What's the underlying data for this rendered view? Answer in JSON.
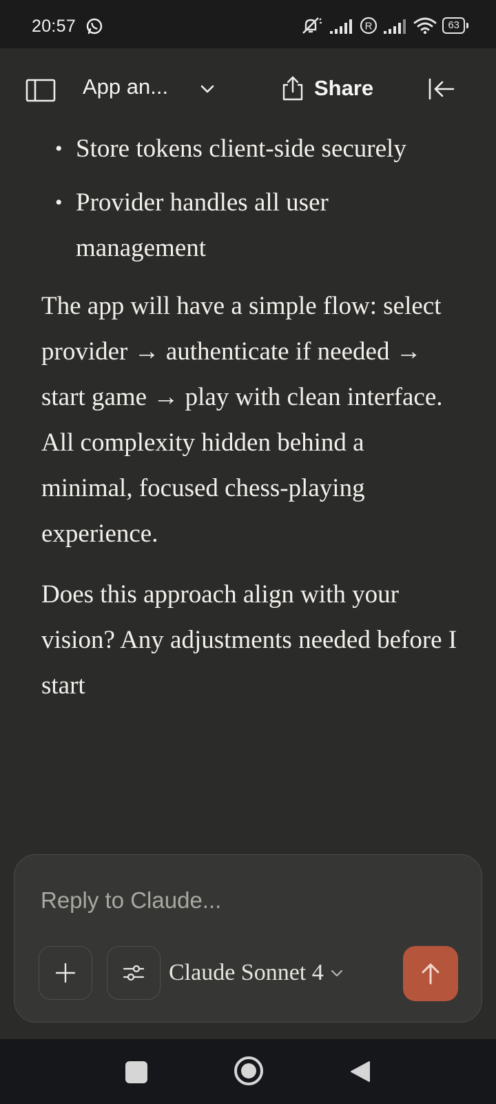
{
  "status_bar": {
    "time": "20:57",
    "battery": "63",
    "icons": [
      "whatsapp-icon",
      "muted-icon",
      "signal-icon",
      "roaming-icon",
      "signal-icon-2",
      "wifi-icon",
      "battery-icon"
    ]
  },
  "header": {
    "title": "App an...",
    "share_label": "Share",
    "icons": [
      "sidebar-icon",
      "chevron-down-icon",
      "share-icon",
      "collapse-icon"
    ]
  },
  "message": {
    "bullets": [
      "Store tokens client-side securely",
      "Provider handles all user management"
    ],
    "paragraphs": [
      "The app will have a simple flow: select provider → authenticate if needed → start game → play with clean interface. All complexity hidden behind a minimal, focused chess-playing experience.",
      "Does this approach align with your vision? Any adjustments needed before I start"
    ]
  },
  "composer": {
    "placeholder": "Reply to Claude...",
    "value": "",
    "model_label": "Claude Sonnet 4",
    "icons": [
      "plus-icon",
      "sliders-icon",
      "chevron-down-icon",
      "arrow-up-icon"
    ],
    "send_color": "#b5553b"
  },
  "nav_bar": {
    "icons": [
      "recents-square-icon",
      "home-circle-icon",
      "back-triangle-icon"
    ]
  },
  "colors": {
    "background": "#2b2b2a",
    "status_bar": "#1b1b1b",
    "nav_bar": "#15171b",
    "text": "#f3f1ec",
    "accent": "#b5553b"
  }
}
